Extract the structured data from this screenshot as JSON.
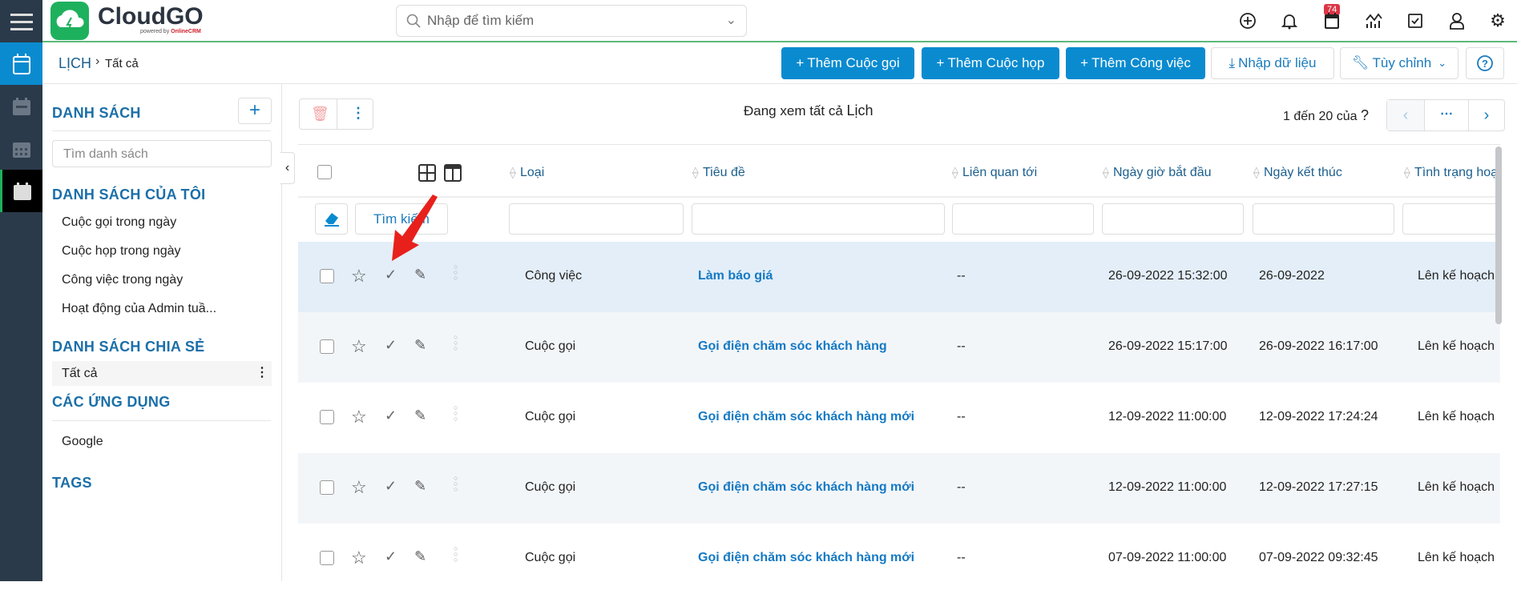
{
  "app": {
    "logo": "CloudGO",
    "logo_sub": "powered by",
    "logo_brand": "OnlineCRM"
  },
  "search": {
    "placeholder": "Nhập để tìm kiếm"
  },
  "notifications": {
    "count": "74"
  },
  "breadcrumb": {
    "module": "LỊCH",
    "current": "Tất cả"
  },
  "actions": {
    "add_call": "Thêm Cuộc gọi",
    "add_meeting": "Thêm Cuộc họp",
    "add_task": "Thêm Công việc",
    "import": "Nhập dữ liệu",
    "customize": "Tùy chỉnh"
  },
  "sidebar": {
    "title": "DANH SÁCH",
    "search_placeholder": "Tìm danh sách",
    "my_lists_title": "DANH SÁCH CỦA TÔI",
    "my_lists": [
      "Cuộc gọi trong ngày",
      "Cuộc họp trong ngày",
      "Công việc trong ngày",
      "Hoạt động của Admin tuầ..."
    ],
    "shared_title": "DANH SÁCH CHIA SẺ",
    "shared": [
      "Tất cả"
    ],
    "apps_title": "CÁC ỨNG DỤNG",
    "apps": [
      "Google"
    ],
    "tags_title": "TAGS"
  },
  "list": {
    "viewing_prefix": "Đang xem tất cả",
    "viewing_module": "Lịch",
    "pagination": "1 đến 20 của",
    "pagination_total": "?",
    "search_button": "Tìm kiếm",
    "columns": [
      "Loại",
      "Tiêu đề",
      "Liên quan tới",
      "Ngày giờ bắt đầu",
      "Ngày kết thúc",
      "Tình trạng hoạt động"
    ],
    "rows": [
      {
        "type": "Công việc",
        "title": "Làm báo giá",
        "related": "--",
        "start": "26-09-2022 15:32:00",
        "end": "26-09-2022",
        "status": "Lên kế hoạch"
      },
      {
        "type": "Cuộc gọi",
        "title": "Gọi điện chăm sóc khách hàng",
        "related": "--",
        "start": "26-09-2022 15:17:00",
        "end": "26-09-2022 16:17:00",
        "status": "Lên kế hoạch"
      },
      {
        "type": "Cuộc gọi",
        "title": "Gọi điện chăm sóc khách hàng mới",
        "related": "--",
        "start": "12-09-2022 11:00:00",
        "end": "12-09-2022 17:24:24",
        "status": "Lên kế hoạch"
      },
      {
        "type": "Cuộc gọi",
        "title": "Gọi điện chăm sóc khách hàng mới",
        "related": "--",
        "start": "12-09-2022 11:00:00",
        "end": "12-09-2022 17:27:15",
        "status": "Lên kế hoạch"
      },
      {
        "type": "Cuộc gọi",
        "title": "Gọi điện chăm sóc khách hàng mới",
        "related": "--",
        "start": "07-09-2022 11:00:00",
        "end": "07-09-2022 09:32:45",
        "status": "Lên kế hoạch"
      }
    ]
  },
  "colors": {
    "accent": "#0a8bd0",
    "rail": "#2b3a4a",
    "brand_green": "#1eb15d",
    "selected_row": "#e3eef8",
    "annotation_arrow": "#e8201c"
  }
}
